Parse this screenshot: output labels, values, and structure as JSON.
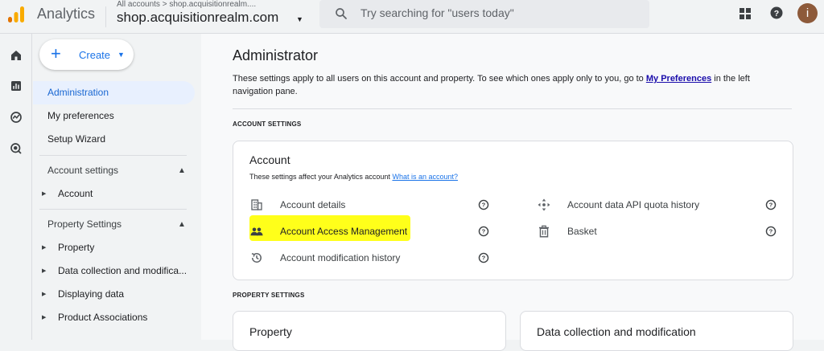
{
  "app": {
    "title": "Analytics",
    "breadcrumb": "All accounts > shop.acquisitionrealm....",
    "property_name": "shop.acquisitionrealm.com",
    "search_placeholder": "Try searching for \"users today\"",
    "avatar_letter": "i",
    "accent_color": "#1a73e8"
  },
  "sidebar": {
    "create_label": "Create",
    "items": [
      {
        "label": "Administration",
        "active": true
      },
      {
        "label": "My preferences",
        "active": false
      },
      {
        "label": "Setup Wizard",
        "active": false
      }
    ],
    "sections": [
      {
        "label": "Account settings",
        "children": [
          "Account"
        ]
      },
      {
        "label": "Property Settings",
        "children": [
          "Property",
          "Data collection and modifica...",
          "Displaying data",
          "Product Associations"
        ]
      }
    ]
  },
  "main": {
    "title": "Administrator",
    "intro_text": "These settings apply to all users on this account and property. To see which ones apply only to you, go to",
    "intro_link": "My Preferences",
    "intro_tail": "in the left navigation pane.",
    "account_settings_heading": "ACCOUNT SETTINGS",
    "property_settings_heading": "PROPERTY SETTINGS",
    "account_card": {
      "title": "Account",
      "subtitle": "These settings affect your Analytics account",
      "subtitle_link": "What is an account?",
      "rows_left": [
        {
          "label": "Account details",
          "icon": "building-icon"
        },
        {
          "label": "Account Access Management",
          "icon": "people-icon",
          "highlighted": true
        },
        {
          "label": "Account modification history",
          "icon": "history-icon"
        }
      ],
      "rows_right": [
        {
          "label": "Account data API quota history",
          "icon": "move-arrows-icon"
        },
        {
          "label": "Basket",
          "icon": "trash-icon"
        }
      ]
    },
    "property_card": {
      "title": "Property"
    },
    "data_collection_card": {
      "title": "Data collection and modification"
    },
    "highlight_color": "#ffff1a"
  }
}
